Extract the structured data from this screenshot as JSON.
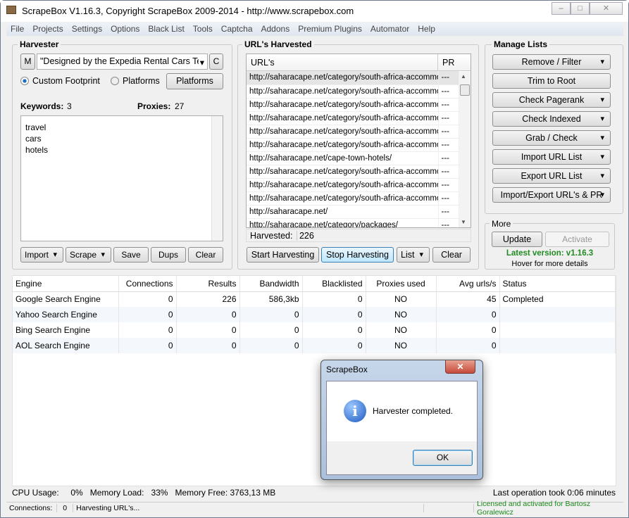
{
  "window": {
    "title": "ScrapeBox V1.16.3, Copyright ScrapeBox 2009-2014 - http://www.scrapebox.com"
  },
  "menu": [
    "File",
    "Projects",
    "Settings",
    "Options",
    "Black List",
    "Tools",
    "Captcha",
    "Addons",
    "Premium Plugins",
    "Automator",
    "Help"
  ],
  "harvester": {
    "title": "Harvester",
    "m_label": "M",
    "footprint": "\"Designed by the Expedia Rental Cars Te",
    "c_label": "C",
    "custom_footprint": "Custom Footprint",
    "platforms_radio": "Platforms",
    "platforms_button": "Platforms",
    "keywords_label": "Keywords:",
    "keywords_count": "3",
    "proxies_label": "Proxies:",
    "proxies_count": "27",
    "keywords": [
      "travel",
      "cars",
      "hotels"
    ],
    "buttons": {
      "import": "Import",
      "scrape": "Scrape",
      "save": "Save",
      "dups": "Dups",
      "clear": "Clear"
    }
  },
  "urls": {
    "title": "URL's Harvested",
    "col_url": "URL's",
    "col_pr": "PR",
    "rows": [
      {
        "url": "http://saharacape.net/category/south-africa-accommo",
        "pr": "---"
      },
      {
        "url": "http://saharacape.net/category/south-africa-accommo",
        "pr": "---"
      },
      {
        "url": "http://saharacape.net/category/south-africa-accommo",
        "pr": "---"
      },
      {
        "url": "http://saharacape.net/category/south-africa-accommo",
        "pr": "---"
      },
      {
        "url": "http://saharacape.net/category/south-africa-accommo",
        "pr": "---"
      },
      {
        "url": "http://saharacape.net/category/south-africa-accommo",
        "pr": "---"
      },
      {
        "url": "http://saharacape.net/cape-town-hotels/",
        "pr": "---"
      },
      {
        "url": "http://saharacape.net/category/south-africa-accommo",
        "pr": "---"
      },
      {
        "url": "http://saharacape.net/category/south-africa-accommo",
        "pr": "---"
      },
      {
        "url": "http://saharacape.net/category/south-africa-accommo",
        "pr": "---"
      },
      {
        "url": "http://saharacape.net/",
        "pr": "---"
      },
      {
        "url": "http://saharacape.net/category/packages/",
        "pr": "---"
      }
    ],
    "harvested_label": "Harvested:",
    "harvested_count": "226",
    "buttons": {
      "start": "Start Harvesting",
      "stop": "Stop Harvesting",
      "list": "List",
      "clear": "Clear"
    }
  },
  "manage": {
    "title": "Manage Lists",
    "buttons": [
      "Remove / Filter",
      "Trim to Root",
      "Check Pagerank",
      "Check Indexed",
      "Grab / Check",
      "Import URL List",
      "Export URL List",
      "Import/Export URL's & PR"
    ]
  },
  "more": {
    "title": "More",
    "update": "Update",
    "activate": "Activate",
    "latest": "Latest version: v1.16.3",
    "hover": "Hover for more details"
  },
  "engines": {
    "headers": [
      "Engine",
      "Connections",
      "Results",
      "Bandwidth",
      "Blacklisted",
      "Proxies used",
      "Avg urls/s",
      "Status"
    ],
    "rows": [
      [
        "Google Search Engine",
        "0",
        "226",
        "586,3kb",
        "0",
        "NO",
        "45",
        "Completed"
      ],
      [
        "Yahoo Search Engine",
        "0",
        "0",
        "0",
        "0",
        "NO",
        "0",
        ""
      ],
      [
        "Bing Search Engine",
        "0",
        "0",
        "0",
        "0",
        "NO",
        "0",
        ""
      ],
      [
        "AOL Search Engine",
        "0",
        "0",
        "0",
        "0",
        "NO",
        "0",
        ""
      ]
    ]
  },
  "stats": {
    "cpu_label": "CPU Usage:",
    "cpu": "0%",
    "mem_label": "Memory Load:",
    "mem": "33%",
    "free": "Memory Free: 3763,13 MB",
    "last_op": "Last operation took 0:06 minutes"
  },
  "statusbar": {
    "connections_label": "Connections:",
    "connections": "0",
    "status": "Harvesting URL's...",
    "license": "Licensed and activated for Bartosz Goralewicz"
  },
  "dialog": {
    "title": "ScrapeBox",
    "message": "Harvester completed.",
    "ok": "OK"
  },
  "colors": {
    "license": "#1a8a1a",
    "latest": "#228b22",
    "close": "#c75050"
  }
}
